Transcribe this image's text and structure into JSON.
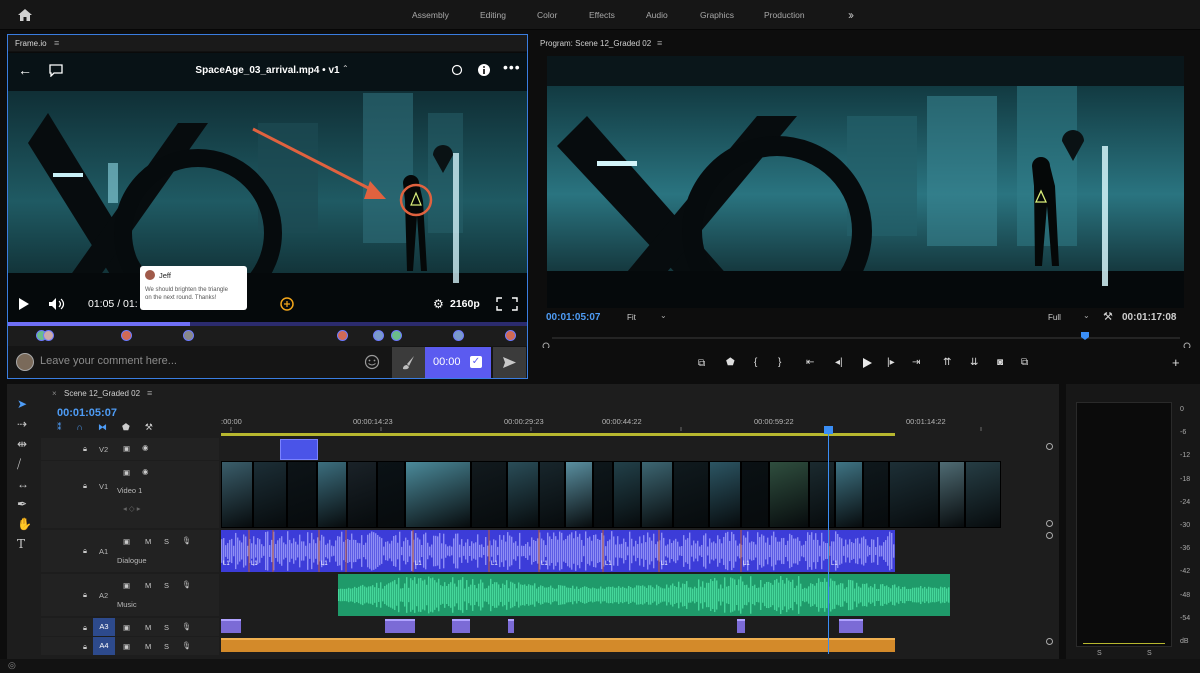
{
  "workspace_bar": {
    "home_icon": "home-icon",
    "tabs": [
      "Assembly",
      "Editing",
      "Color",
      "Effects",
      "Audio",
      "Graphics",
      "Production"
    ],
    "more_icon": "double-chevron-right-icon"
  },
  "frameio_panel": {
    "title": "Frame.io",
    "file_title": "SpaceAge_03_arrival.mp4 • v1",
    "timecode": "01:05 / 01:",
    "resolution": "2160p",
    "progress": 0.35,
    "comment": {
      "author": "Jeff",
      "text_line1": "We should brighten the triangle",
      "text_line2": "on the next round. Thanks!"
    },
    "comment_placeholder": "Leave your comment here...",
    "comment_timecode": "00:00",
    "annotation_color": "#e0623f",
    "accent_color": "#5b5bf0"
  },
  "program_monitor": {
    "title": "Program: Scene 12_Graded 02",
    "current_timecode": "00:01:05:07",
    "fit_option": "Fit",
    "quality_option": "Full",
    "duration_timecode": "00:01:17:08"
  },
  "timeline": {
    "sequence_name": "Scene 12_Graded 02",
    "current_timecode": "00:01:05:07",
    "ruler_labels": [
      ":00:00",
      "00:00:14:23",
      "00:00:29:23",
      "00:00:44:22",
      "00:00:59:22",
      "00:01:14:22"
    ],
    "tracks": [
      {
        "id": "V2",
        "name": ""
      },
      {
        "id": "V1",
        "name": "Video 1"
      },
      {
        "id": "A1",
        "name": "Dialogue"
      },
      {
        "id": "A2",
        "name": "Music"
      },
      {
        "id": "A3",
        "name": ""
      },
      {
        "id": "A4",
        "name": ""
      }
    ],
    "track_buttons": {
      "mute": "M",
      "solo": "S"
    },
    "clip_label": "L1",
    "colors": {
      "video_clip": "#4a54e8",
      "dialogue": "#3c3cd8",
      "music": "#1f9a6a",
      "a3_clip": "#7b6bd6",
      "a4_clip": "#d38a2a",
      "playhead": "#3a8ef5"
    }
  },
  "audio_meter": {
    "labels": [
      "0",
      "-6",
      "-12",
      "-18",
      "-24",
      "-30",
      "-36",
      "-42",
      "-48",
      "-54",
      "dB"
    ],
    "solo_labels": [
      "S",
      "S"
    ]
  }
}
